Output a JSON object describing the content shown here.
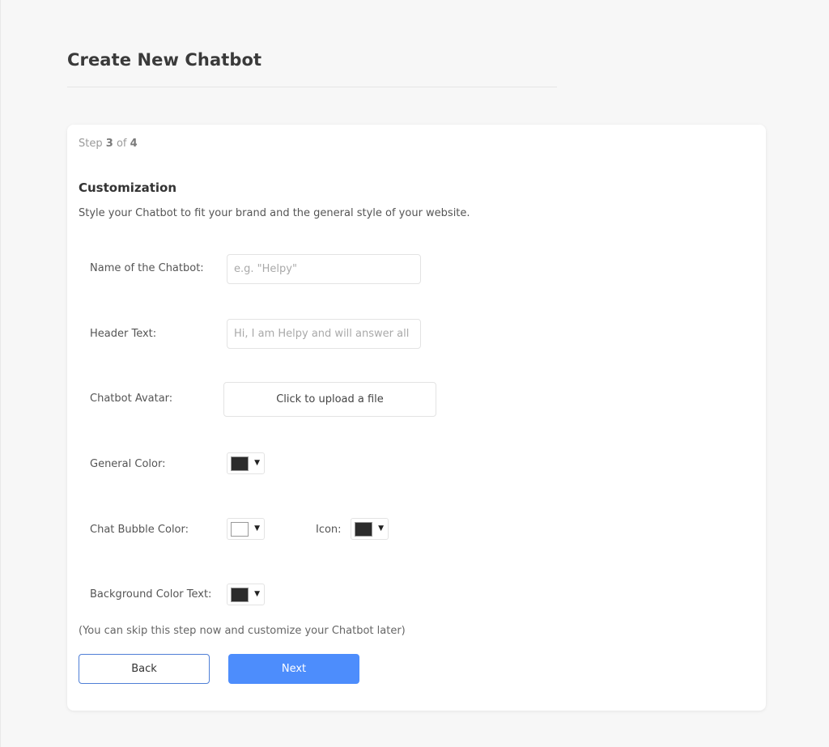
{
  "page": {
    "title": "Create New Chatbot"
  },
  "step": {
    "prefix": "Step",
    "current": "3",
    "separator": "of",
    "total": "4"
  },
  "section": {
    "title": "Customization",
    "description": "Style your Chatbot to fit your brand and the general style of your website."
  },
  "fields": {
    "name": {
      "label": "Name of the Chatbot:",
      "value": "",
      "placeholder": "e.g. \"Helpy\""
    },
    "header_text": {
      "label": "Header Text:",
      "value": "",
      "placeholder": "Hi, I am Helpy and will answer all"
    },
    "avatar": {
      "label": "Chatbot Avatar:",
      "button_label": "Click to upload a file"
    },
    "general_color": {
      "label": "General Color:",
      "color": "#2b2b2b",
      "caret": "▼"
    },
    "chat_bubble_color": {
      "label": "Chat Bubble Color:",
      "color": "#ffffff",
      "caret": "▼"
    },
    "icon_color": {
      "label": "Icon:",
      "color": "#2b2b2b",
      "caret": "▼"
    },
    "background_color_text": {
      "label": "Background Color Text:",
      "color": "#2b2b2b",
      "caret": "▼"
    }
  },
  "skip_note": "(You can skip this step now and customize your Chatbot later)",
  "buttons": {
    "back": "Back",
    "next": "Next"
  },
  "colors": {
    "accent": "#4d8dfc",
    "back_border": "#4f7fd6"
  }
}
